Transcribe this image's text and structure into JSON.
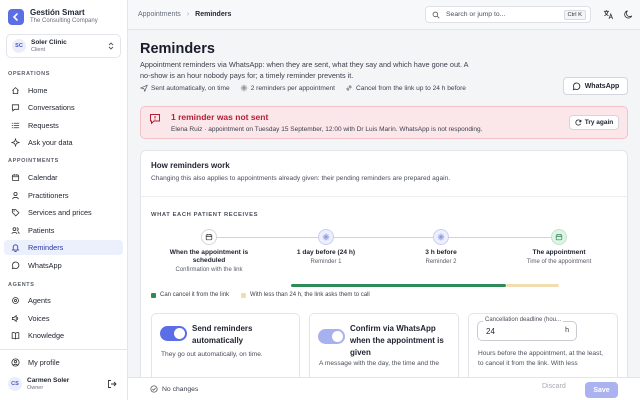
{
  "brand": {
    "title": "Gestión Smart",
    "subtitle": "The Consulting Company",
    "icon": "arrow-left-icon"
  },
  "clinic": {
    "initials": "SC",
    "name": "Soler Clinic",
    "role": "Client"
  },
  "sidebar": {
    "sections": [
      "OPERATIONS",
      "APPOINTMENTS",
      "AGENTS"
    ],
    "operations": [
      {
        "label": "Home",
        "icon": "home-icon"
      },
      {
        "label": "Conversations",
        "icon": "chat-icon"
      },
      {
        "label": "Requests",
        "icon": "list-icon"
      },
      {
        "label": "Ask your data",
        "icon": "sparkle-icon"
      }
    ],
    "appointments": [
      {
        "label": "Calendar",
        "icon": "calendar-icon"
      },
      {
        "label": "Practitioners",
        "icon": "user-icon"
      },
      {
        "label": "Services and prices",
        "icon": "tag-icon"
      },
      {
        "label": "Patients",
        "icon": "users-icon"
      },
      {
        "label": "Reminders",
        "icon": "bell-icon",
        "active": true
      },
      {
        "label": "WhatsApp",
        "icon": "whatsapp-icon"
      }
    ],
    "agents": [
      {
        "label": "Agents",
        "icon": "bot-icon"
      },
      {
        "label": "Voices",
        "icon": "voice-icon"
      },
      {
        "label": "Knowledge",
        "icon": "book-icon"
      }
    ],
    "profile": {
      "label": "My profile",
      "icon": "user-circle-icon"
    },
    "user": {
      "initials": "CS",
      "name": "Carmen Soler",
      "role": "Owner"
    }
  },
  "topbar": {
    "crumb_parent": "Appointments",
    "crumb_current": "Reminders",
    "search_placeholder": "Search or jump to...",
    "shortcut": "Ctrl K"
  },
  "page": {
    "title": "Reminders",
    "lead": "Appointment reminders via WhatsApp: when they are sent, what they say and which have gone out. A no-show is an hour nobody pays for; a timely reminder prevents it.",
    "meta": [
      "Sent automatically, on time",
      "2 reminders per appointment",
      "Cancel from the link up to 24 h before"
    ],
    "whatsapp_button": "WhatsApp"
  },
  "alert": {
    "title": "1 reminder was not sent",
    "text": "Elena Ruiz · appointment on Tuesday 15 September, 12:00 with Dr Luis Marín. WhatsApp is not responding.",
    "button": "Try again"
  },
  "how": {
    "title": "How reminders work",
    "subtitle": "Changing this also applies to appointments already given: their pending reminders are prepared again.",
    "section": "WHAT EACH PATIENT RECEIVES",
    "steps": [
      {
        "title": "When the appointment is scheduled",
        "sub": "Confirmation with the link",
        "icon": "calendar-icon"
      },
      {
        "title": "1 day before (24 h)",
        "sub": "Reminder 1",
        "icon": "gear-icon"
      },
      {
        "title": "3 h before",
        "sub": "Reminder 2",
        "icon": "gear-icon"
      },
      {
        "title": "The appointment",
        "sub": "Time of the appointment",
        "icon": "calendar-check-icon"
      }
    ],
    "legend": [
      "Can cancel it from the link",
      "With less than 24 h, the link asks them to call"
    ],
    "colors": {
      "cancel": "#2e8b57",
      "call": "#f3ddb0"
    }
  },
  "options": {
    "send": {
      "title": "Send reminders automatically",
      "desc": "They go out automatically, on time.",
      "on": true
    },
    "confirm": {
      "title": "Confirm via WhatsApp when the appointment is given",
      "desc": "A message with the day, the time and the",
      "on": true
    },
    "deadline": {
      "label": "Cancellation deadline (hou...",
      "value": "24",
      "unit": "h",
      "desc": "Hours before the appointment, at the least, to cancel it from the link. With less"
    }
  },
  "footer": {
    "status": "No changes",
    "discard": "Discard",
    "save": "Save"
  }
}
